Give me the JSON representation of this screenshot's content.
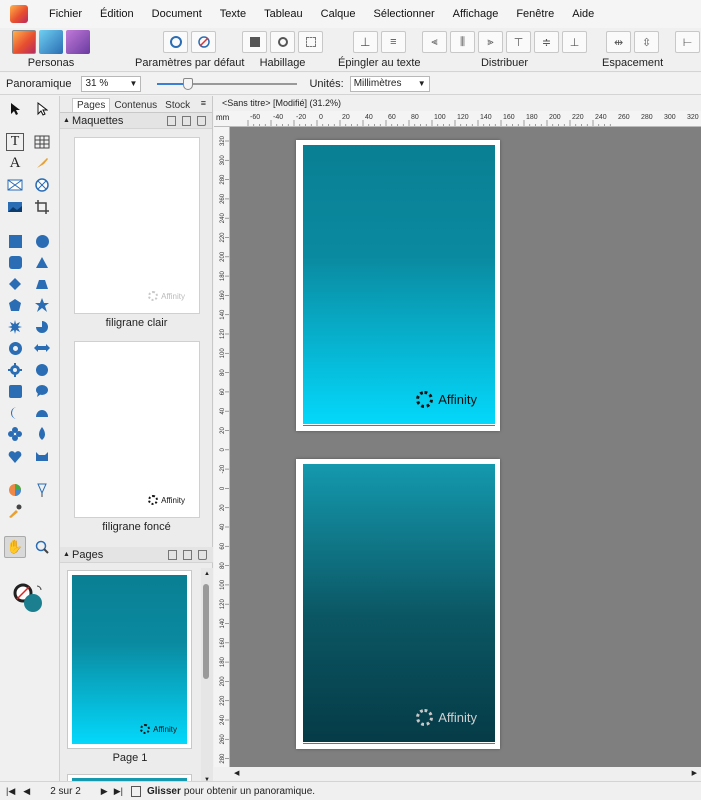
{
  "menubar": {
    "items": [
      "Fichier",
      "Édition",
      "Document",
      "Texte",
      "Tableau",
      "Calque",
      "Sélectionner",
      "Affichage",
      "Fenêtre",
      "Aide"
    ]
  },
  "toolbar": {
    "personas_label": "Personas",
    "defaults_label": "Paramètres par défaut",
    "wrap_label": "Habillage",
    "pin_label": "Épingler au texte",
    "distribute_label": "Distribuer",
    "spacing_label": "Espacement"
  },
  "context": {
    "tool_name": "Panoramique",
    "zoom_value": "31 %",
    "zoom_level_percent": 31,
    "units_label": "Unités:",
    "units_value": "Millimètres"
  },
  "panel": {
    "tabs": [
      "Pages",
      "Contenus",
      "Stock"
    ],
    "masters_title": "Maquettes",
    "masters": [
      {
        "label": "filigrane clair",
        "watermark": "Affinity"
      },
      {
        "label": "filigrane foncé",
        "watermark": "Affinity"
      }
    ],
    "pages_title": "Pages",
    "pages": [
      {
        "label": "Page 1",
        "watermark": "Affinity"
      }
    ]
  },
  "canvas": {
    "tab_title": "<Sans titre> [Modifié] (31.2%)",
    "ruler_unit": "mm",
    "ruler_top_ticks": [
      "-60",
      "-40",
      "-20",
      "0",
      "20",
      "40",
      "60",
      "80",
      "100",
      "120",
      "140",
      "160",
      "180",
      "200",
      "220",
      "240",
      "260",
      "280",
      "300",
      "320"
    ],
    "ruler_left_ticks": [
      "320",
      "300",
      "280",
      "260",
      "240",
      "220",
      "200",
      "180",
      "160",
      "140",
      "120",
      "100",
      "80",
      "60",
      "40",
      "20",
      "0",
      "-20",
      "0",
      "20",
      "40",
      "60",
      "80",
      "100",
      "120",
      "140",
      "160",
      "180",
      "200",
      "220",
      "240",
      "260",
      "280"
    ],
    "pages": [
      {
        "watermark": "Affinity",
        "gradient_top": "#0a7f93",
        "gradient_bottom": "#04d8fb"
      },
      {
        "watermark": "Affinity",
        "gradient_top": "#1499ae",
        "gradient_bottom": "#053b47"
      }
    ]
  },
  "status": {
    "page_counter": "2 sur 2",
    "hint_bold": "Glisser",
    "hint_rest": "pour obtenir un panoramique."
  }
}
